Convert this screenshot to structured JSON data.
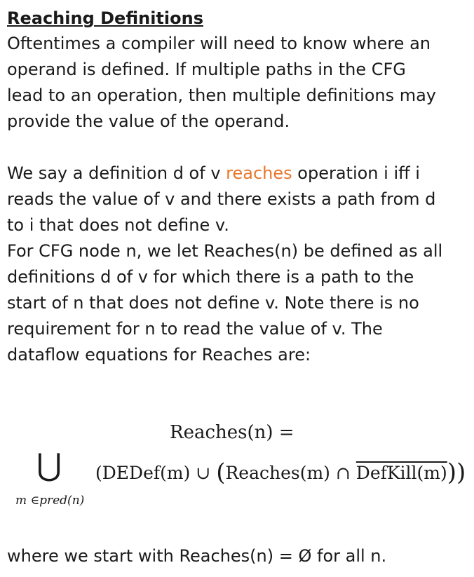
{
  "title": "Reaching Definitions",
  "para1": [
    "Oftentimes a compiler will need to know where an",
    "operand is defined.  If multiple paths in the CFG",
    "lead to an operation, then multiple definitions may",
    "provide the value of the operand."
  ],
  "para2": {
    "line1_before": "We say a definition d of v ",
    "line1_highlight": "reaches",
    "line1_after": " operation i iff i",
    "lines": [
      "reads the value of v and there exists a path from d",
      "to i that does not define v."
    ]
  },
  "para3": [
    "For CFG node n, we let Reaches(n) be defined as all",
    "definitions d of v for which there is a path to the",
    "start of n that does not define v.  Note there is no",
    "requirement for n to read the value of v.  The",
    "dataflow equations for Reaches are:"
  ],
  "equation": {
    "lhs": "Reaches(n) =",
    "union_symbol": "⋃",
    "subscript": "m ∈pred(n)",
    "rhs_part1": "(DEDef(m) ∪ ",
    "rhs_open": "(",
    "rhs_part2": "Reaches(m) ∩ ",
    "rhs_overlined": "DefKill(m)",
    "rhs_close": "))"
  },
  "final_line": "where we start with Reaches(n) = Ø for all n.",
  "colors": {
    "highlight": "#e8762b",
    "text": "#1a1a1a"
  }
}
